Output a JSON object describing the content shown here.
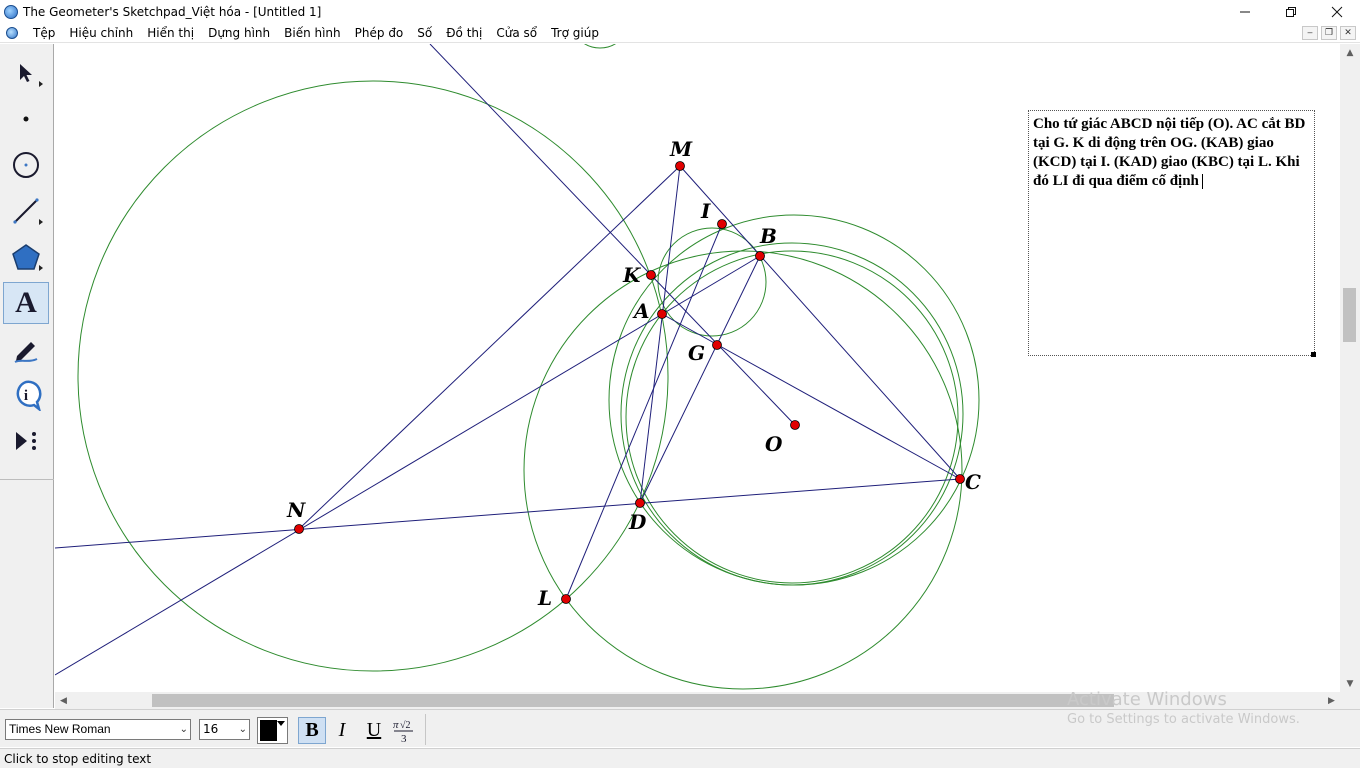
{
  "window": {
    "title": "The Geometer's Sketchpad_Việt hóa - [Untitled 1]",
    "minimize_icon": "minimize-icon",
    "maximize_icon": "restore-icon",
    "close_icon": "close-icon"
  },
  "menu": {
    "items": [
      "Tệp",
      "Hiệu chỉnh",
      "Hiển thị",
      "Dựng hình",
      "Biến hình",
      "Phép đo",
      "Số",
      "Đồ thị",
      "Cửa sổ",
      "Trợ giúp"
    ]
  },
  "toolbox": {
    "tools": [
      {
        "name": "arrow-select-tool",
        "icon": "arrow-icon"
      },
      {
        "name": "point-tool",
        "icon": "point-icon"
      },
      {
        "name": "compass-tool",
        "icon": "circle-icon"
      },
      {
        "name": "straightedge-tool",
        "icon": "line-icon"
      },
      {
        "name": "polygon-tool",
        "icon": "polygon-icon"
      },
      {
        "name": "text-tool",
        "icon": "text-A-icon",
        "label": "A"
      },
      {
        "name": "marker-tool",
        "icon": "marker-icon"
      },
      {
        "name": "information-tool",
        "icon": "info-icon",
        "label": "i"
      },
      {
        "name": "custom-tool",
        "icon": "custom-tool-icon"
      }
    ]
  },
  "points": {
    "M": "M",
    "I": "I",
    "B": "B",
    "K": "K",
    "A": "A",
    "G": "G",
    "O": "O",
    "C": "C",
    "N": "N",
    "D": "D",
    "L": "L"
  },
  "caption": {
    "text": "Cho tứ giác ABCD nội tiếp (O). AC cắt BD tại G. K di động trên OG. (KAB) giao (KCD) tại I. (KAD) giao (KBC) tại L. Khi đó LI đi qua điểm cố định"
  },
  "colors": {
    "circle_stroke": "#2e8b2e",
    "line_stroke": "#1f1f7a",
    "point_fill": "#e00000"
  },
  "format_bar": {
    "font_family": "Times New Roman",
    "font_size": "16",
    "text_color": "#000000",
    "bold_label": "B",
    "italic_label": "I",
    "underline_label": "U",
    "math_format_icon": "math-format-icon"
  },
  "watermark": {
    "line1": "Activate Windows",
    "line2": "Go to Settings to activate Windows."
  },
  "status": {
    "text": "Click to stop editing text"
  }
}
